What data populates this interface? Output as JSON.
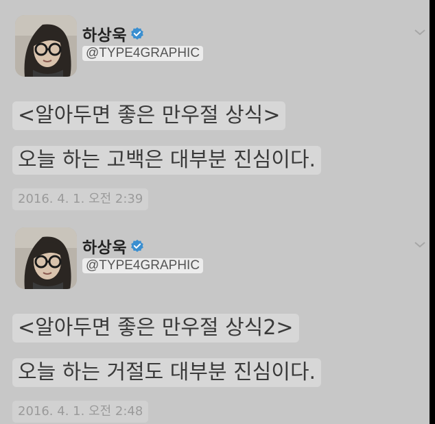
{
  "colors": {
    "background": "#c7c7c7",
    "verified": "#3b8fd0",
    "text_highlight": "#d7d7d7"
  },
  "tweets": [
    {
      "author": {
        "name": "하상욱",
        "handle": "@TYPE4GRAPHIC",
        "verified_icon": "verified-badge-icon"
      },
      "lines": [
        "<알아두면 좋은 만우절 상식>",
        "오늘 하는 고백은 대부분 진심이다."
      ],
      "timestamp": "2016. 4. 1. 오전 2:39",
      "menu_icon": "chevron-down-icon"
    },
    {
      "author": {
        "name": "하상욱",
        "handle": "@TYPE4GRAPHIC",
        "verified_icon": "verified-badge-icon"
      },
      "lines": [
        "<알아두면 좋은 만우절 상식2>",
        "오늘 하는 거절도 대부분 진심이다."
      ],
      "timestamp": "2016. 4. 1. 오전 2:48",
      "menu_icon": "chevron-down-icon"
    }
  ]
}
